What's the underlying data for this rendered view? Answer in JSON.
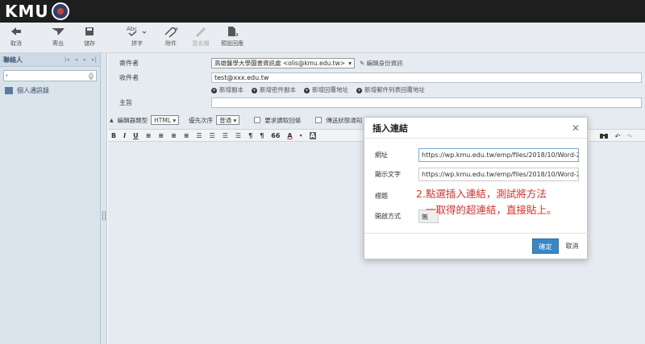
{
  "header": {
    "logo_text": "KMU"
  },
  "toolbar": {
    "cancel": "取消",
    "send": "寄出",
    "save": "儲存",
    "spell": "拼字",
    "attach": "附件",
    "sign": "簽名檔",
    "read_receipt": "預設回應"
  },
  "sidebar": {
    "title": "聯絡人",
    "search_placeholder": "",
    "item": "個人通訊錄"
  },
  "compose": {
    "from_label": "寄件者",
    "from_value": "高雄醫學大學圖書資訊處 <olis@kmu.edu.tw>",
    "edit_identity": "編輯身份資訊",
    "to_label": "收件者",
    "to_value": "test@xxx.edu.tw",
    "add_links": [
      "新增副本",
      "新增密件副本",
      "新增回覆地址",
      "新增郵件列表回覆地址"
    ],
    "subject_label": "主旨",
    "subject_value": "",
    "editor_type_label": "編輯器類型",
    "editor_type_value": "HTML",
    "priority_label": "優先次序",
    "priority_value": "普通",
    "request_receipt": "要求讀取回條",
    "delivery_status": "傳送狀態通知"
  },
  "format_toolbar": [
    "B",
    "I",
    "U",
    "≡",
    "≡",
    "≡",
    "≡",
    "☰",
    "☰",
    "☰",
    "☰",
    "¶",
    "¶",
    "66",
    "A",
    "A"
  ],
  "dialog": {
    "title": "插入連結",
    "url_label": "網址",
    "url_value": "https://wp.kmu.edu.tw/emp/files/2018/10/Word-20",
    "text_label": "顯示文字",
    "text_value": "https://wp.kmu.edu.tw/emp/files/2018/10/Word-20",
    "title_label": "標題",
    "target_label": "開啟方式",
    "target_value": "無",
    "ok": "確定",
    "cancel": "取消"
  },
  "note": {
    "line1": "2.點選插入連結，測試將方法",
    "line2": "一取得的超連結，直接貼上。"
  },
  "colors": {
    "accent": "#3a87c6",
    "note": "#d9302c",
    "header": "#1e1e1e"
  }
}
